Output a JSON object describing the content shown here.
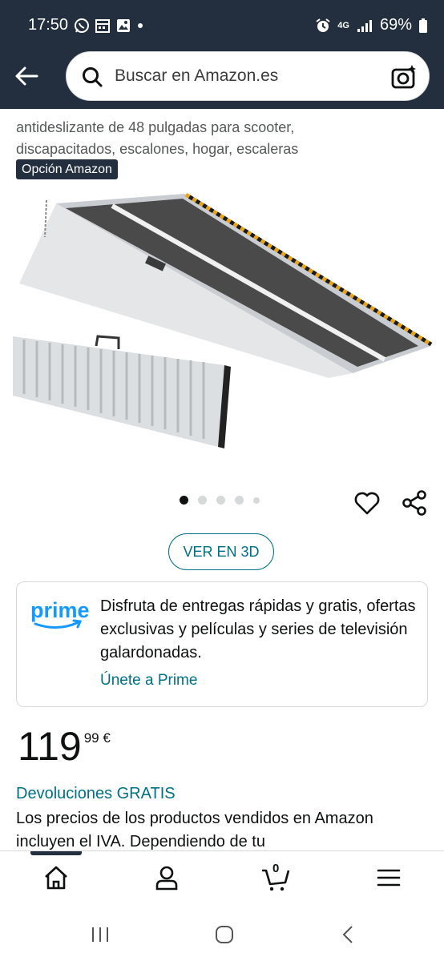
{
  "status": {
    "time": "17:50",
    "battery": "69%",
    "network": "4G"
  },
  "search": {
    "placeholder": "Buscar en Amazon.es"
  },
  "product": {
    "title_line_1": "antideslizante de 48 pulgadas para scooter,",
    "title_line_2": "discapacitados, escalones, hogar, escaleras",
    "badge": "Opción Amazon",
    "view_3d_label": "VER EN 3D",
    "image_count": 5,
    "active_image": 1
  },
  "prime": {
    "logo_text": "prime",
    "description": "Disfruta de entregas rápidas y gratis, ofertas exclusivas y películas y series de televisión galardonadas.",
    "link": "Únete a Prime"
  },
  "price": {
    "whole": "119",
    "fraction": "99 €"
  },
  "returns": {
    "link": "Devoluciones GRATIS",
    "text": "Los precios de los productos vendidos en Amazon incluyen el IVA. Dependiendo de tu"
  },
  "bottom_nav": {
    "cart_count": "0"
  },
  "colors": {
    "header_bg": "#232f3e",
    "link": "#007185",
    "prime_blue": "#1399ff"
  }
}
